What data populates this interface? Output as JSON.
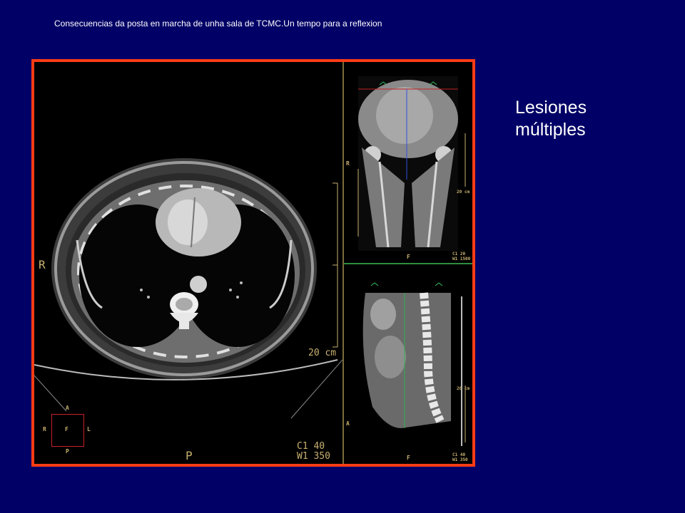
{
  "slide": {
    "title": "Consecuencias da posta en marcha de unha sala de TCMC.Un tempo para a reflexion",
    "heading_line1": "Lesiones",
    "heading_line2": "múltiples"
  },
  "viewer": {
    "border_color": "#ff3c14",
    "axial": {
      "label_left": "R",
      "label_bottom": "P",
      "scale": "20 cm",
      "window_center": "C1   40",
      "window_width": "W1  350",
      "orientation": {
        "top": "A",
        "left": "R",
        "center": "F",
        "right": "L",
        "bottom": "P"
      }
    },
    "coronal": {
      "label_left": "R",
      "label_bottom": "F",
      "scale": "20 cm",
      "window_center": "C1   20",
      "window_width": "W1 1500"
    },
    "sagittal": {
      "label_left": "A",
      "label_bottom": "F",
      "scale": "20 cm",
      "window_center": "C1   40",
      "window_width": "W1  350"
    }
  }
}
